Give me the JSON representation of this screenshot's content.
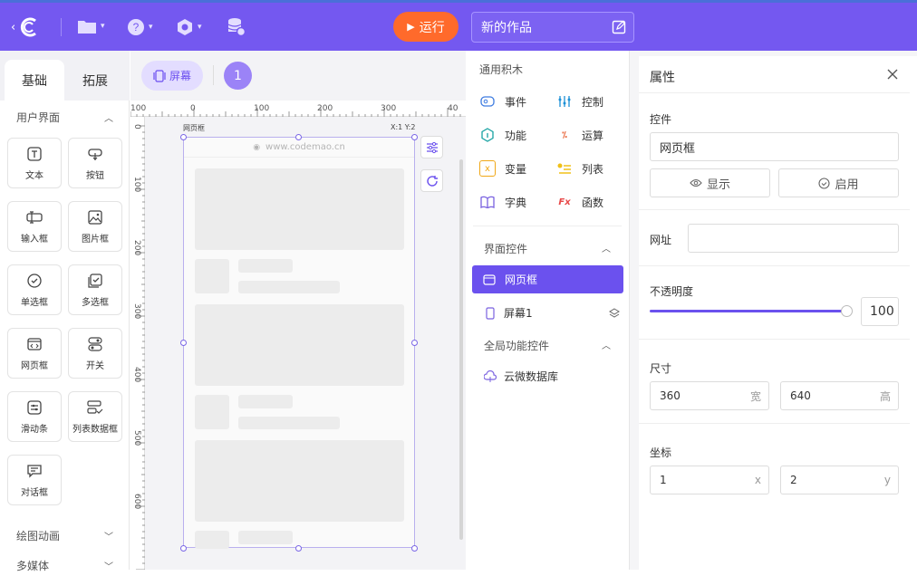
{
  "topbar": {
    "run_label": "运行",
    "project_title": "新的作品"
  },
  "left": {
    "tabs": [
      "基础",
      "拓展"
    ],
    "section_ui": "用户界面",
    "widgets": [
      "文本",
      "按钮",
      "输入框",
      "图片框",
      "单选框",
      "多选框",
      "网页框",
      "开关",
      "滑动条",
      "列表数据框",
      "对话框"
    ],
    "section_draw": "绘图动画",
    "section_media": "多媒体"
  },
  "canvas": {
    "screen_label": "屏幕",
    "screen_number": "1",
    "ruler_h": [
      "100",
      "0",
      "100",
      "200",
      "300",
      "40"
    ],
    "ruler_v": [
      "0",
      "100",
      "200",
      "300",
      "400",
      "500",
      "600"
    ],
    "widget_caption": "网页框",
    "coord_readout": "X:1 Y:2",
    "url_text": "www.codemao.cn"
  },
  "blocks": {
    "header_general": "通用积木",
    "items": [
      "事件",
      "控制",
      "功能",
      "运算",
      "变量",
      "列表",
      "字典",
      "函数"
    ],
    "header_ui": "界面控件",
    "ui_items": [
      "网页框",
      "屏幕1"
    ],
    "header_global": "全局功能控件",
    "global_items": [
      "云微数据库"
    ]
  },
  "props": {
    "title": "属性",
    "control_label": "控件",
    "control_name": "网页框",
    "show_label": "显示",
    "enable_label": "启用",
    "url_label": "网址",
    "url_value": "",
    "opacity_label": "不透明度",
    "opacity_value": "100",
    "size_label": "尺寸",
    "width": "360",
    "width_unit": "宽",
    "height": "640",
    "height_unit": "高",
    "coord_label": "坐标",
    "x": "1",
    "x_unit": "x",
    "y": "2",
    "y_unit": "y"
  },
  "colors": {
    "brand": "#7458f0",
    "run": "#ff6a2b",
    "accent": "#6b51ee"
  }
}
